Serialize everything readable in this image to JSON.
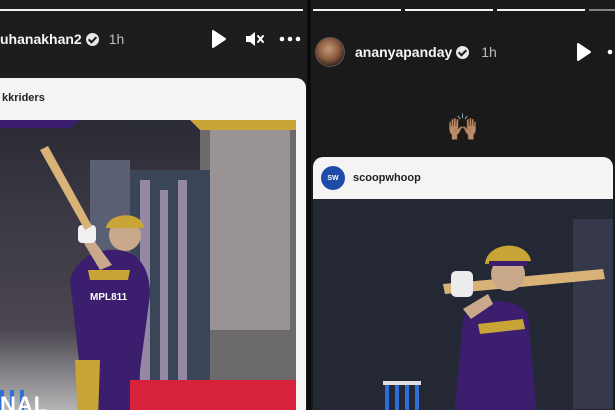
{
  "left_story": {
    "username": "uhanakhan2",
    "time": "1h",
    "post": {
      "account": "kkriders",
      "overlay_text": "NAL",
      "jersey_text": "MPL811"
    },
    "controls": [
      "play-icon",
      "mute-icon",
      "more-icon"
    ]
  },
  "right_story": {
    "username": "ananyapanday",
    "time": "1h",
    "emoji": "🙌🏽",
    "post": {
      "account": "scoopwhoop",
      "logo_text": "SW"
    },
    "controls": [
      "play-icon",
      "more-icon"
    ]
  },
  "colors": {
    "kkr_purple": "#3b1f6e",
    "kkr_gold": "#c9a437",
    "background": "#1d1d1d"
  }
}
